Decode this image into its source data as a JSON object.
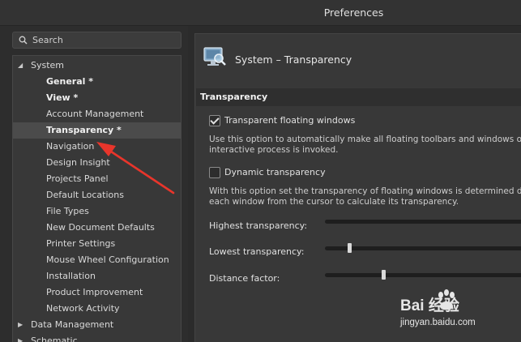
{
  "window": {
    "title": "Preferences"
  },
  "search": {
    "placeholder": "Search"
  },
  "tree": {
    "system_label": "System",
    "children": [
      "General *",
      "View *",
      "Account Management",
      "Transparency *",
      "Navigation",
      "Design Insight",
      "Projects Panel",
      "Default Locations",
      "File Types",
      "New Document Defaults",
      "Printer Settings",
      "Mouse Wheel Configuration",
      "Installation",
      "Product Improvement",
      "Network Activity"
    ],
    "data_management_label": "Data Management",
    "schematic_label": "Schematic",
    "selected": "Transparency *"
  },
  "header": {
    "title": "System – Transparency",
    "icon": "monitor-magnifier-icon"
  },
  "section": {
    "title": "Transparency"
  },
  "options": {
    "floating": {
      "label": "Transparent floating windows",
      "checked": true,
      "desc1": "Use this option to automatically make all floating toolbars and windows ov",
      "desc2": "interactive process is invoked."
    },
    "dynamic": {
      "label": "Dynamic transparency",
      "checked": false,
      "desc1": "With this option set the transparency of floating windows is determined dy",
      "desc2": "each window from the cursor to calculate its transparency."
    }
  },
  "sliders": {
    "highest": {
      "label": "Highest transparency:",
      "value": 0
    },
    "lowest": {
      "label": "Lowest transparency:",
      "value": 0.12
    },
    "distance": {
      "label": "Distance factor:",
      "value": 0.29
    }
  },
  "watermark": {
    "brand": "Bai  经验",
    "url": "jingyan.baidu.com"
  },
  "colors": {
    "arrow": "#e8352b",
    "panel": "#383838",
    "background": "#2b2b2b"
  }
}
